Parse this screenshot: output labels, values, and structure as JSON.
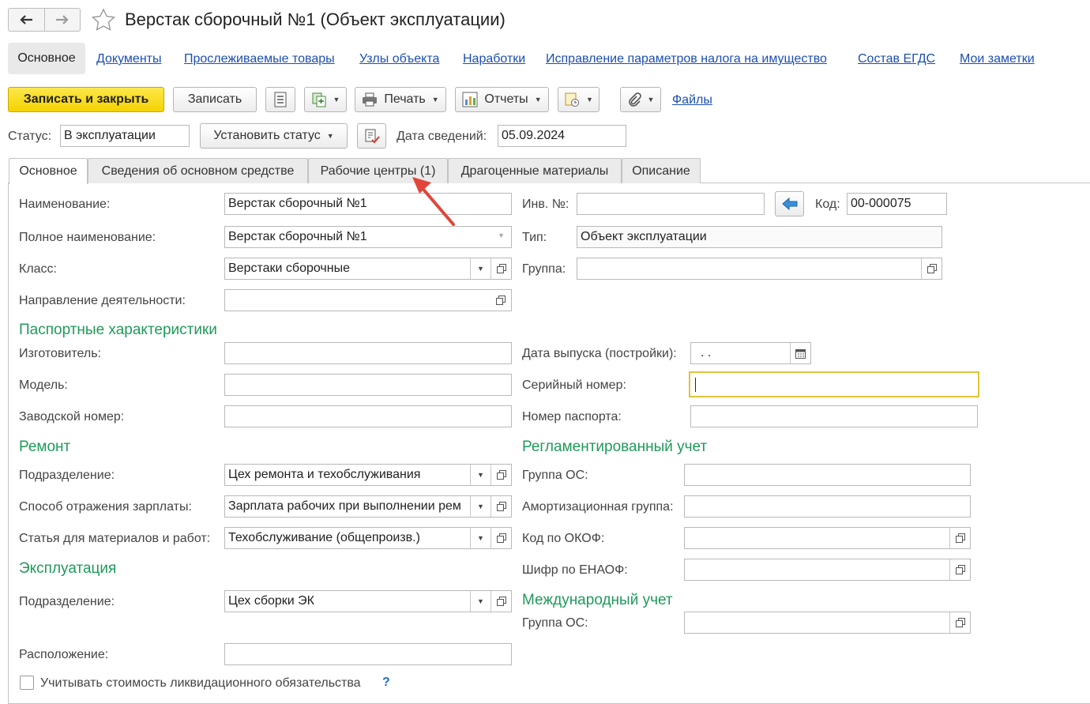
{
  "window": {
    "title": "Верстак сборочный №1 (Объект эксплуатации)"
  },
  "sections": {
    "active": "Основное",
    "links": [
      "Документы",
      "Прослеживаемые товары",
      "Узлы объекта",
      "Наработки",
      "Исправление параметров налога на имущество",
      "Состав ЕГДС",
      "Мои заметки"
    ]
  },
  "toolbar": {
    "save_close": "Записать и закрыть",
    "save": "Записать",
    "print": "Печать",
    "reports": "Отчеты",
    "files": "Файлы"
  },
  "status": {
    "label": "Статус:",
    "value": "В эксплуатации",
    "set_status": "Установить статус",
    "date_label": "Дата сведений:",
    "date_value": "05.09.2024"
  },
  "tabs": [
    "Основное",
    "Сведения об основном средстве",
    "Рабочие центры (1)",
    "Драгоценные материалы",
    "Описание"
  ],
  "form": {
    "name": {
      "label": "Наименование:",
      "value": "Верстак сборочный №1"
    },
    "full_name": {
      "label": "Полное наименование:",
      "value": "Верстак сборочный №1"
    },
    "class": {
      "label": "Класс:",
      "value": "Верстаки сборочные"
    },
    "direction": {
      "label": "Направление деятельности:",
      "value": ""
    },
    "inv": {
      "label": "Инв. №:",
      "value": ""
    },
    "code": {
      "label": "Код:",
      "value": "00-000075"
    },
    "type": {
      "label": "Тип:",
      "value": "Объект эксплуатации"
    },
    "group": {
      "label": "Группа:",
      "value": ""
    }
  },
  "passport": {
    "title": "Паспортные характеристики",
    "manufacturer": {
      "label": "Изготовитель:",
      "value": ""
    },
    "model": {
      "label": "Модель:",
      "value": ""
    },
    "factory_no": {
      "label": "Заводской номер:",
      "value": ""
    },
    "release_date": {
      "label": "Дата выпуска (постройки):",
      "value": " .  ."
    },
    "serial_no": {
      "label": "Серийный номер:",
      "value": ""
    },
    "passport_no": {
      "label": "Номер паспорта:",
      "value": ""
    }
  },
  "repair": {
    "title": "Ремонт",
    "division": {
      "label": "Подразделение:",
      "value": "Цех ремонта и техобслуживания"
    },
    "salary": {
      "label": "Способ отражения зарплаты:",
      "value": "Зарплата рабочих при выполнении рем"
    },
    "article": {
      "label": "Статья для материалов и работ:",
      "value": "Техобслуживание (общепроизв.)"
    }
  },
  "regulated": {
    "title": "Регламентированный учет",
    "os_group": {
      "label": "Группа ОС:",
      "value": ""
    },
    "amort_group": {
      "label": "Амортизационная группа:",
      "value": ""
    },
    "okof": {
      "label": "Код по ОКОФ:",
      "value": ""
    },
    "enaof": {
      "label": "Шифр по ЕНАОФ:",
      "value": ""
    }
  },
  "operation": {
    "title": "Эксплуатация",
    "division": {
      "label": "Подразделение:",
      "value": "Цех сборки ЭК"
    },
    "location": {
      "label": "Расположение:",
      "value": ""
    }
  },
  "international": {
    "title": "Международный учет",
    "os_group": {
      "label": "Группа ОС:",
      "value": ""
    }
  },
  "liquidation": {
    "label": "Учитывать стоимость ликвидационного обязательства",
    "help": "?"
  },
  "colors": {
    "accent_green": "#1f9a5a",
    "link_blue": "#1c4fb0",
    "primary_yellow": "#f4d200",
    "annotation_red": "#e0463a"
  }
}
